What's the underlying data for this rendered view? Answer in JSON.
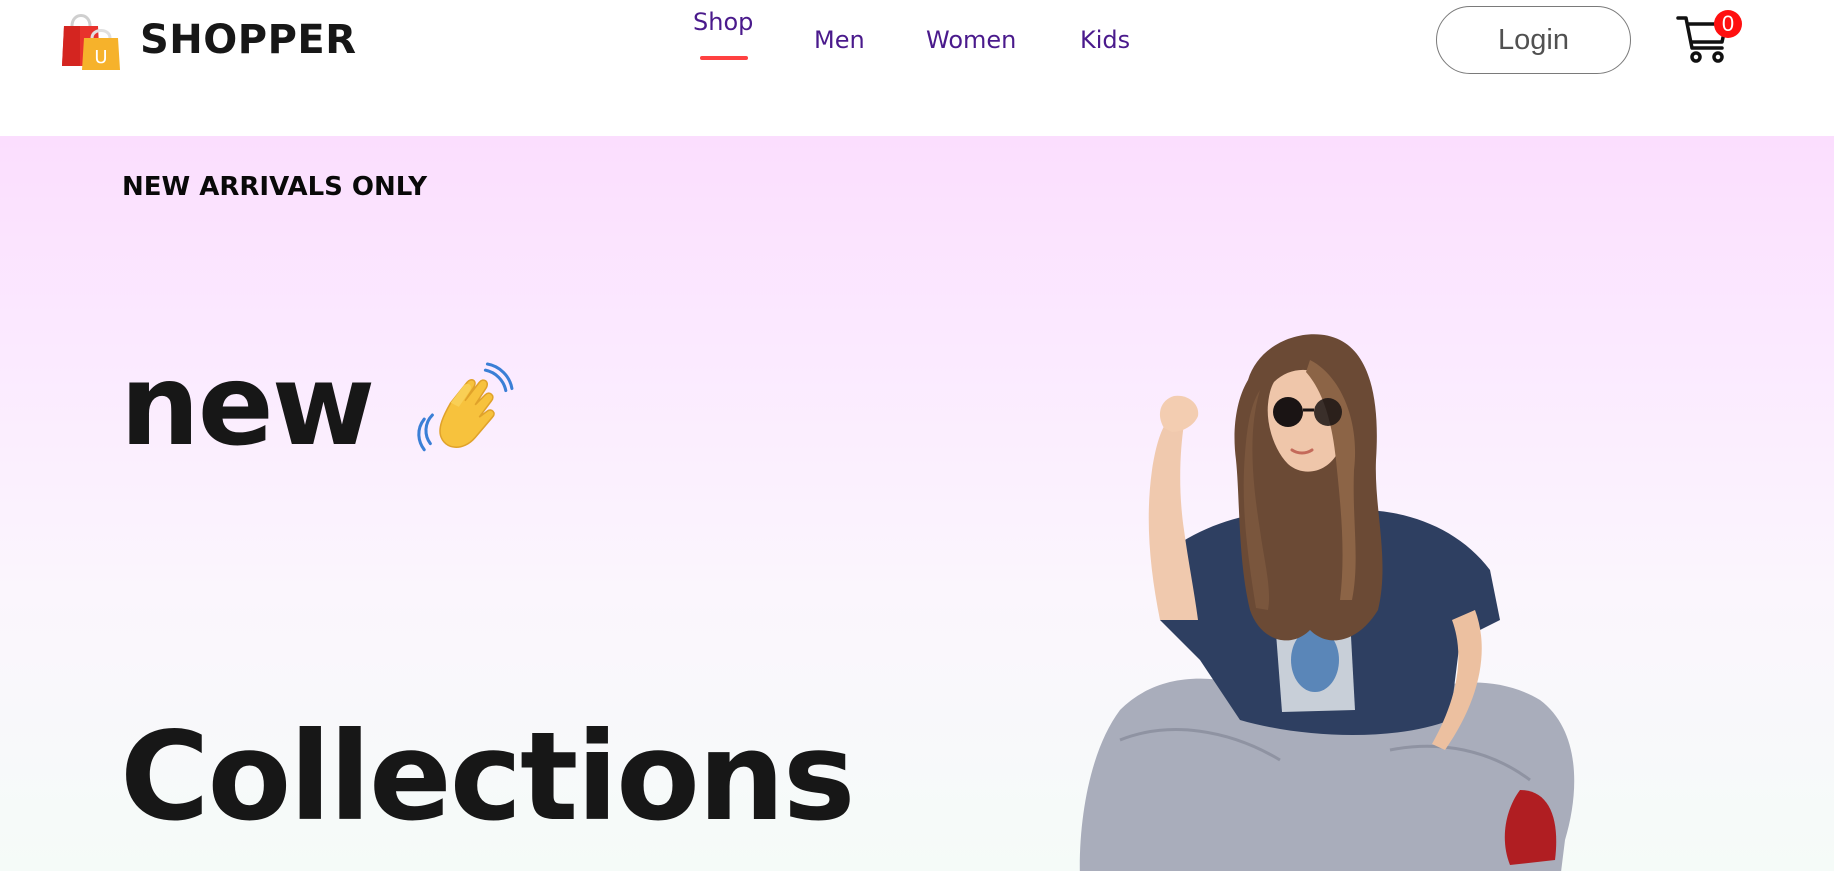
{
  "brand": {
    "name": "SHOPPER",
    "logo_icon": "shopping-bag-icon",
    "logo_letter": "U"
  },
  "nav": {
    "items": [
      {
        "label": "Shop",
        "active": true
      },
      {
        "label": "Men",
        "active": false
      },
      {
        "label": "Women",
        "active": false
      },
      {
        "label": "Kids",
        "active": false
      }
    ],
    "active_underline_color": "#ff4141",
    "item_color": "#4a1a8c"
  },
  "header": {
    "login_label": "Login",
    "cart_icon": "cart-icon",
    "cart_count": "0"
  },
  "hero": {
    "tag": "NEW ARRIVALS ONLY",
    "line1": "new",
    "hand_icon": "waving-hand-icon",
    "line2": "Collections",
    "image": "model-photo"
  },
  "colors": {
    "hero_gradient_top": "#fbdefe",
    "hero_gradient_bottom": "#f5fbf8",
    "badge": "#ff1010"
  }
}
